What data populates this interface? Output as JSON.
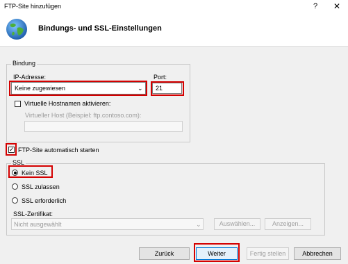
{
  "window": {
    "title": "FTP-Site hinzufügen",
    "help_glyph": "?",
    "close_glyph": "✕"
  },
  "header": {
    "heading": "Bindungs- und SSL-Einstellungen",
    "icon": "globe-icon"
  },
  "binding": {
    "group_label": "Bindung",
    "ip_label": "IP-Adresse:",
    "ip_value": "Keine zugewiesen",
    "port_label": "Port:",
    "port_value": "21",
    "virtual_hostnames_label": "Virtuelle Hostnamen aktivieren:",
    "virtual_hostnames_checked": false,
    "virtual_host_label": "Virtueller Host (Beispiel: ftp.contoso.com):",
    "virtual_host_value": ""
  },
  "autostart": {
    "label": "FTP-Site automatisch starten",
    "checked": true
  },
  "ssl": {
    "group_label": "SSL",
    "options": [
      "Kein SSL",
      "SSL zulassen",
      "SSL erforderlich"
    ],
    "selected": "Kein SSL",
    "cert_label": "SSL-Zertifikat:",
    "cert_value": "Nicht ausgewählt",
    "select_button": "Auswählen...",
    "view_button": "Anzeigen..."
  },
  "footer": {
    "back": "Zurück",
    "next": "Weiter",
    "finish": "Fertig stellen",
    "cancel": "Abbrechen"
  },
  "colors": {
    "highlight": "#d40000",
    "panel": "#f0f0f0"
  }
}
